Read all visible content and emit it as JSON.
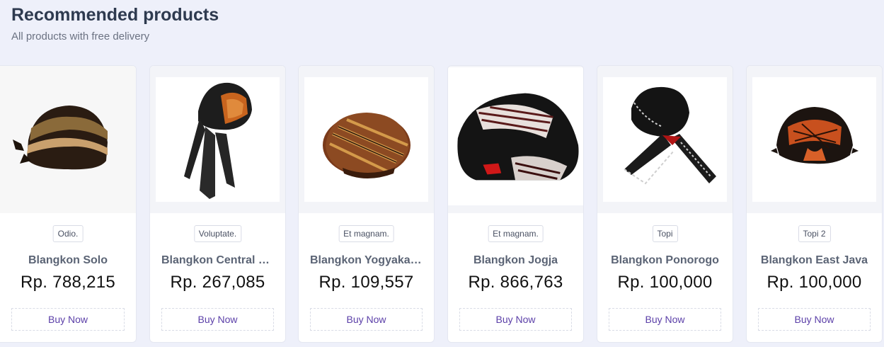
{
  "header": {
    "title": "Recommended products",
    "subtitle": "All products with free delivery"
  },
  "products": [
    {
      "category": "Odio.",
      "name": "Blangkon Solo",
      "price": "Rp. 788,215",
      "buy_label": "Buy Now",
      "icon": "blangkon-solo-image"
    },
    {
      "category": "Voluptate.",
      "name": "Blangkon Central Java",
      "price": "Rp. 267,085",
      "buy_label": "Buy Now",
      "icon": "blangkon-central-java-image"
    },
    {
      "category": "Et magnam.",
      "name": "Blangkon Yogyakarta",
      "price": "Rp. 109,557",
      "buy_label": "Buy Now",
      "icon": "blangkon-yogyakarta-image"
    },
    {
      "category": "Et magnam.",
      "name": "Blangkon Jogja",
      "price": "Rp. 866,763",
      "buy_label": "Buy Now",
      "icon": "blangkon-jogja-image"
    },
    {
      "category": "Topi",
      "name": "Blangkon Ponorogo",
      "price": "Rp. 100,000",
      "buy_label": "Buy Now",
      "icon": "blangkon-ponorogo-image"
    },
    {
      "category": "Topi 2",
      "name": "Blangkon East Java",
      "price": "Rp. 100,000",
      "buy_label": "Buy Now",
      "icon": "blangkon-east-java-image"
    }
  ],
  "colors": {
    "background": "#eef0fa",
    "accent": "#5b3fa8",
    "title": "#2e3a4f"
  }
}
